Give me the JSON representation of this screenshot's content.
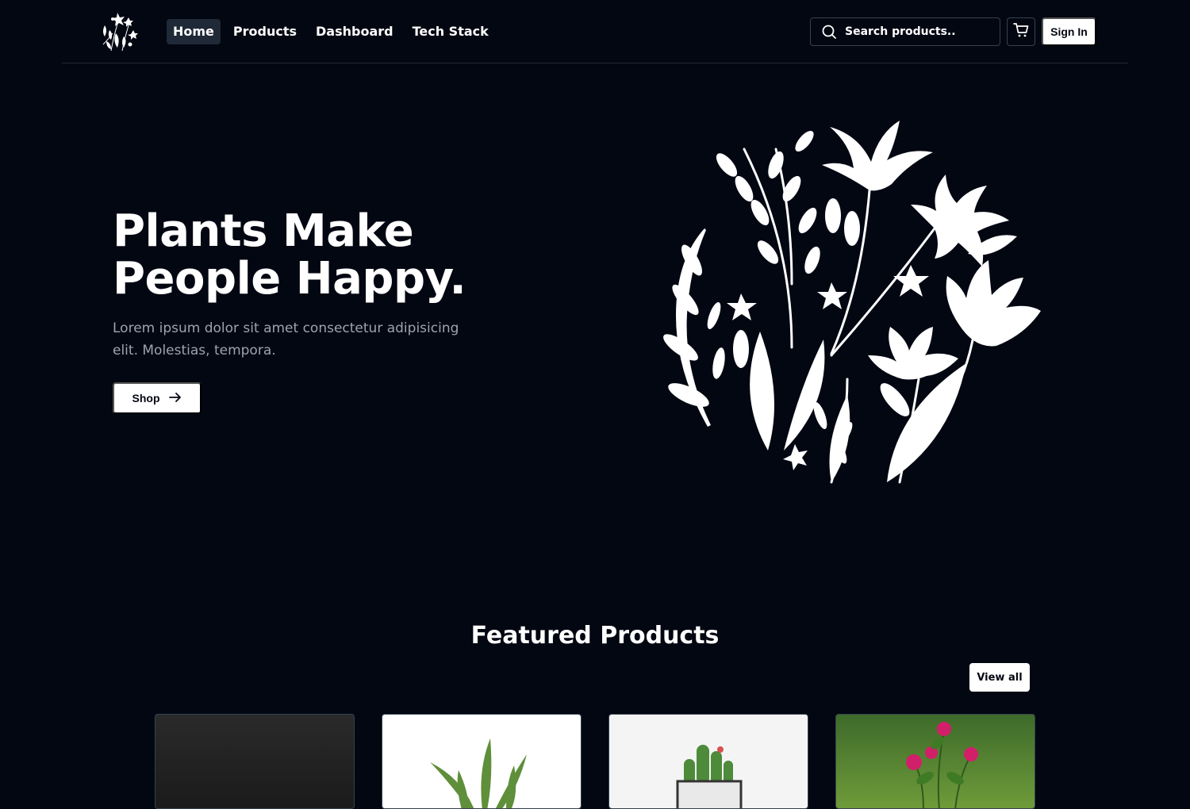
{
  "header": {
    "nav": [
      {
        "label": "Home",
        "active": true
      },
      {
        "label": "Products",
        "active": false
      },
      {
        "label": "Dashboard",
        "active": false
      },
      {
        "label": "Tech Stack",
        "active": false
      }
    ],
    "search": {
      "placeholder": "Search products.."
    },
    "cart_icon": "shopping-cart-icon",
    "signin_label": "Sign In"
  },
  "hero": {
    "title_line1": "Plants Make",
    "title_line2": "People Happy.",
    "subtitle": "Lorem ipsum dolor sit amet consectetur adipisicing elit. Molestias, tempora.",
    "cta_label": "Shop",
    "cta_icon": "arrow-right-icon"
  },
  "featured": {
    "title": "Featured Products",
    "view_all_label": "View all"
  },
  "colors": {
    "background": "#030712",
    "foreground": "#ffffff",
    "border": "#1f2937"
  }
}
